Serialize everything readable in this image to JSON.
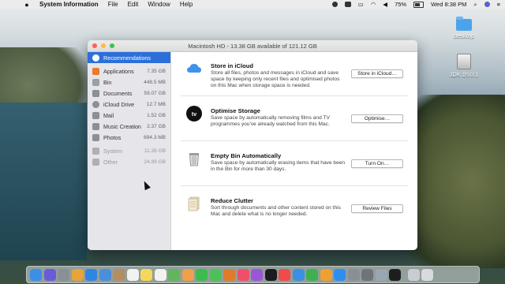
{
  "menubar": {
    "app_name": "System Information",
    "menus": [
      "File",
      "Edit",
      "Window",
      "Help"
    ],
    "battery": "75%",
    "clock": "Wed 8:38 PM"
  },
  "window": {
    "title": "Macintosh HD - 13.38 GB available of 121.12 GB"
  },
  "sidebar": {
    "items": [
      {
        "label": "Recommendations",
        "value": "",
        "icon": "lightbulb-icon",
        "color": "#5ba4f5"
      },
      {
        "label": "Applications",
        "value": "7.35 GB",
        "icon": "applications-icon",
        "color": "#e87b2c"
      },
      {
        "label": "Bin",
        "value": "448.5 MB",
        "icon": "bin-icon",
        "color": "#9aa0a6"
      },
      {
        "label": "Documents",
        "value": "59.07 GB",
        "icon": "documents-icon",
        "color": "#8c8f94"
      },
      {
        "label": "iCloud Drive",
        "value": "12.7 MB",
        "icon": "cloud-icon",
        "color": "#8c8f94"
      },
      {
        "label": "Mail",
        "value": "1.52 GB",
        "icon": "mail-icon",
        "color": "#8c8f94"
      },
      {
        "label": "Music Creation",
        "value": "2.37 GB",
        "icon": "music-creation-icon",
        "color": "#8c8f94"
      },
      {
        "label": "Photos",
        "value": "694.3 MB",
        "icon": "photos-icon",
        "color": "#8c8f94"
      },
      {
        "label": "System",
        "value": "11.26 GB",
        "icon": "system-icon",
        "color": "#b0b0b4"
      },
      {
        "label": "Other",
        "value": "24.89 GB",
        "icon": "other-icon",
        "color": "#b0b0b4"
      }
    ]
  },
  "recommendations": [
    {
      "title": "Store in iCloud",
      "description": "Store all files, photos and messages in iCloud and save space by keeping only recent files and optimised photos on this Mac when storage space is needed.",
      "button": "Store in iCloud…",
      "icon": "icloud-icon"
    },
    {
      "title": "Optimise Storage",
      "description": "Save space by automatically removing films and TV programmes you've already watched from this Mac.",
      "button": "Optimise…",
      "icon": "apple-tv-icon",
      "icon_text": "tv"
    },
    {
      "title": "Empty Bin Automatically",
      "description": "Save space by automatically erasing items that have been in the Bin for more than 30 days.",
      "button": "Turn On…",
      "icon": "trash-icon"
    },
    {
      "title": "Reduce Clutter",
      "description": "Sort through documents and other content stored on this Mac and delete what is no longer needed.",
      "button": "Review Files",
      "icon": "document-stack-icon"
    }
  ],
  "desktop": {
    "icons": [
      {
        "label": "desktop",
        "icon": "folder-icon"
      },
      {
        "label": "JDK 15.0.1",
        "icon": "disk-image-icon"
      }
    ]
  },
  "dock": {
    "apps": [
      {
        "name": "finder-icon",
        "color": "#3b8fe5"
      },
      {
        "name": "siri-icon",
        "color": "#6b5ad8"
      },
      {
        "name": "launchpad-icon",
        "color": "#8a8f96"
      },
      {
        "name": "chrome-icon",
        "color": "#e8a33b"
      },
      {
        "name": "safari-icon",
        "color": "#2f86e0"
      },
      {
        "name": "mail-icon",
        "color": "#4a8fd9"
      },
      {
        "name": "contacts-icon",
        "color": "#b48e63"
      },
      {
        "name": "calendar-icon",
        "color": "#f2f2f2"
      },
      {
        "name": "notes-icon",
        "color": "#f5d75a"
      },
      {
        "name": "reminders-icon",
        "color": "#f2f2f2"
      },
      {
        "name": "maps-icon",
        "color": "#62b55c"
      },
      {
        "name": "photos-icon",
        "color": "#f0a04b"
      },
      {
        "name": "facetime-icon",
        "color": "#3dbb4f"
      },
      {
        "name": "messages-icon",
        "color": "#4fbf5a"
      },
      {
        "name": "books-icon",
        "color": "#e07b2a"
      },
      {
        "name": "music-icon",
        "color": "#f04f6a"
      },
      {
        "name": "podcasts-icon",
        "color": "#9b55d9"
      },
      {
        "name": "tv-icon",
        "color": "#1c1c1e"
      },
      {
        "name": "news-icon",
        "color": "#f04a4a"
      },
      {
        "name": "keynote-icon",
        "color": "#3d8fe0"
      },
      {
        "name": "numbers-icon",
        "color": "#3faf4f"
      },
      {
        "name": "pages-icon",
        "color": "#f0a030"
      },
      {
        "name": "app-store-icon",
        "color": "#2e8ef0"
      },
      {
        "name": "system-preferences-icon",
        "color": "#8a8f96"
      },
      {
        "name": "screenshot-icon",
        "color": "#6f7478"
      },
      {
        "name": "preview-icon",
        "color": "#9aa7b3"
      },
      {
        "name": "terminal-icon",
        "color": "#1e1e1e"
      },
      {
        "name": "system-information-icon",
        "color": "#c9ccd0"
      },
      {
        "name": "trash-icon",
        "color": "#d8dadd"
      }
    ]
  }
}
